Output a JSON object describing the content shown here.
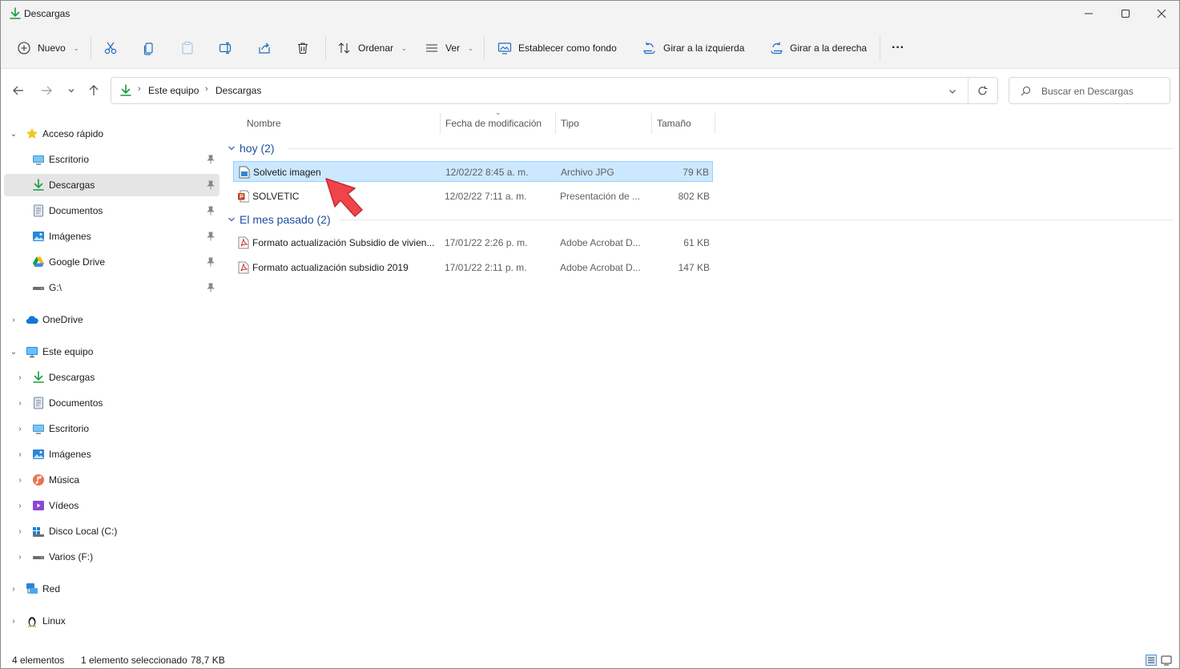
{
  "window": {
    "title": "Descargas"
  },
  "toolbar": {
    "new_label": "Nuevo",
    "sort_label": "Ordenar",
    "view_label": "Ver",
    "set_background_label": "Establecer como fondo",
    "rotate_left_label": "Girar a la izquierda",
    "rotate_right_label": "Girar a la derecha",
    "more_label": "···"
  },
  "address": {
    "crumbs": [
      "Este equipo",
      "Descargas"
    ],
    "search_placeholder": "Buscar en Descargas"
  },
  "sidebar": {
    "quick_access": {
      "label": "Acceso rápido",
      "items": [
        {
          "label": "Escritorio",
          "icon": "desktop-icon"
        },
        {
          "label": "Descargas",
          "icon": "download-icon",
          "selected": true
        },
        {
          "label": "Documentos",
          "icon": "documents-icon"
        },
        {
          "label": "Imágenes",
          "icon": "pictures-icon"
        },
        {
          "label": "Google Drive",
          "icon": "google-drive-icon"
        },
        {
          "label": "G:\\",
          "icon": "drive-icon"
        }
      ]
    },
    "onedrive": {
      "label": "OneDrive"
    },
    "this_pc": {
      "label": "Este equipo",
      "items": [
        {
          "label": "Descargas",
          "icon": "download-icon"
        },
        {
          "label": "Documentos",
          "icon": "documents-icon"
        },
        {
          "label": "Escritorio",
          "icon": "desktop-icon"
        },
        {
          "label": "Imágenes",
          "icon": "pictures-icon"
        },
        {
          "label": "Música",
          "icon": "music-icon"
        },
        {
          "label": "Vídeos",
          "icon": "videos-icon"
        },
        {
          "label": "Disco Local (C:)",
          "icon": "local-disk-icon"
        },
        {
          "label": "Varios (F:)",
          "icon": "drive-icon"
        }
      ]
    },
    "network": {
      "label": "Red"
    },
    "linux": {
      "label": "Linux"
    }
  },
  "list": {
    "columns": [
      "Nombre",
      "Fecha de modificación",
      "Tipo",
      "Tamaño"
    ],
    "groups": [
      {
        "label": "hoy (2)",
        "files": [
          {
            "name": "Solvetic imagen",
            "date": "12/02/22 8:45 a. m.",
            "type": "Archivo JPG",
            "size": "79 KB",
            "icon": "jpg-file-icon",
            "selected": true
          },
          {
            "name": "SOLVETIC",
            "date": "12/02/22 7:11 a. m.",
            "type": "Presentación de ...",
            "size": "802 KB",
            "icon": "powerpoint-file-icon"
          }
        ]
      },
      {
        "label": "El mes pasado (2)",
        "files": [
          {
            "name": "Formato actualización Subsidio de vivien...",
            "date": "17/01/22 2:26 p. m.",
            "type": "Adobe Acrobat D...",
            "size": "61 KB",
            "icon": "pdf-file-icon"
          },
          {
            "name": "Formato actualización subsidio 2019",
            "date": "17/01/22 2:11 p. m.",
            "type": "Adobe Acrobat D...",
            "size": "147 KB",
            "icon": "pdf-file-icon"
          }
        ]
      }
    ]
  },
  "status": {
    "count": "4 elementos",
    "selection": "1 elemento seleccionado",
    "size": "78,7 KB"
  },
  "colors": {
    "accent": "#0067c0",
    "selection_bg": "#cce8ff",
    "selection_border": "#99d1ff",
    "group_header": "#1f4e9e",
    "annotation_arrow": "#f0444b"
  }
}
